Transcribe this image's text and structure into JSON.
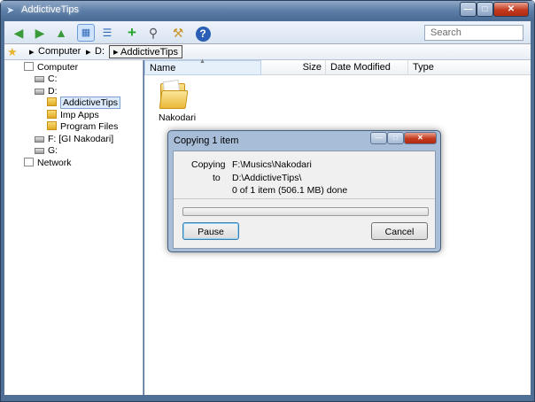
{
  "window": {
    "title": "AddictiveTips"
  },
  "toolbar": {
    "search_placeholder": "Search",
    "icons": [
      "back-arrow-icon",
      "forward-arrow-icon",
      "up-arrow-icon",
      "icon-view-icon",
      "details-view-icon",
      "add-icon",
      "magnifier-icon",
      "tools-icon",
      "help-icon"
    ]
  },
  "address": {
    "items": [
      "Computer",
      "D:",
      "AddictiveTips"
    ]
  },
  "tree": {
    "items": [
      {
        "label": "Computer"
      },
      {
        "label": "C:"
      },
      {
        "label": "D:"
      },
      {
        "label": "AddictiveTips"
      },
      {
        "label": "Imp Apps"
      },
      {
        "label": "Program Files"
      },
      {
        "label": "F: [GI Nakodari]"
      },
      {
        "label": "G:"
      },
      {
        "label": "Network"
      }
    ]
  },
  "columns": [
    "Name",
    "Size",
    "Date Modified",
    "Type"
  ],
  "files": [
    {
      "name": "Nakodari"
    }
  ],
  "dialog": {
    "title": "Copying 1 item",
    "copying_label": "Copying",
    "source": "F:\\Musics\\Nakodari",
    "to_label": "to",
    "destination": "D:\\AddictiveTips\\",
    "progress_text": "0 of 1 item  (506.1 MB) done",
    "progress_fraction": 0,
    "pause_label": "Pause",
    "cancel_label": "Cancel"
  },
  "colors": {
    "accent": "#4f6f95",
    "progress": "#37b84a"
  }
}
